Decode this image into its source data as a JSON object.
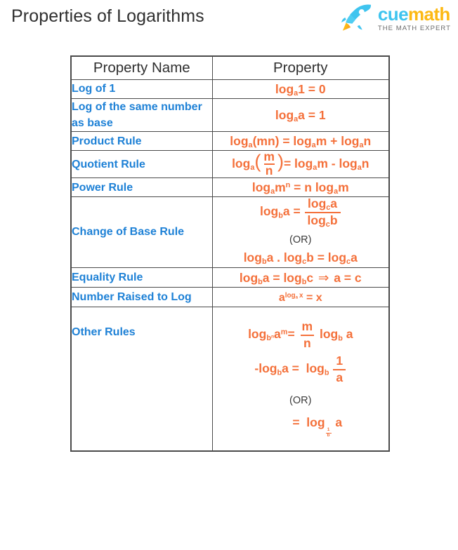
{
  "header": {
    "title": "Properties of Logarithms",
    "logo": {
      "icon": "rocket-icon",
      "word_1": "cue",
      "word_2": "math",
      "tagline": "THE MATH EXPERT",
      "color_cue": "#3FC4EF",
      "color_math": "#FDB913",
      "color_tagline": "#6b6b6b"
    }
  },
  "colors": {
    "property_name": "#1E81D6",
    "formula": "#F4703A",
    "border": "#4a4a4a",
    "heading": "#2f2f2f",
    "or_text": "#3a3a3a"
  },
  "table": {
    "columns": [
      "Property Name",
      "Property"
    ],
    "rows": [
      {
        "name": "Log of 1",
        "formula_text": "log_a 1 = 0",
        "log_base": "a",
        "arg": "1",
        "result": "0"
      },
      {
        "name": "Log of the same number as base",
        "formula_text": "log_a a = 1",
        "log_base": "a",
        "arg": "a",
        "result": "1"
      },
      {
        "name": "Product Rule",
        "formula_text": "log_a(mn) = log_a m + log_a n",
        "base": "a",
        "left_arg": "(mn)",
        "op": "+",
        "right_1": "m",
        "right_2": "n"
      },
      {
        "name": "Quotient Rule",
        "formula_text": "log_a(m/n) = log_a m - log_a n",
        "base": "a",
        "numerator": "m",
        "denominator": "n",
        "op": "-",
        "right_1": "m",
        "right_2": "n"
      },
      {
        "name": "Power Rule",
        "formula_text": "log_a m^n = n log_a m",
        "base": "a",
        "arg": "m",
        "exponent": "n",
        "coefficient": "n"
      },
      {
        "name": "Change of Base Rule",
        "formula_text": "log_b a = log_c a / log_c b",
        "alt_text": "log_b a . log_c b = log_c a",
        "or_label": "(OR)",
        "base_b": "b",
        "base_c": "c",
        "arg_a": "a",
        "arg_b": "b"
      },
      {
        "name": "Equality Rule",
        "formula_text": "log_b a = log_b c  ⇒  a = c",
        "base": "b",
        "arg_1": "a",
        "arg_2": "c",
        "implies": "⇒"
      },
      {
        "name": "Number Raised to Log",
        "formula_text": "a^(log_a x) = x",
        "base": "a",
        "log_base": "a",
        "arg": "x",
        "result": "x"
      },
      {
        "name": "Other Rules",
        "formula_1": "log_(b^n) a^m = (m/n) log_b a",
        "formula_2": "-log_b a = log_b (1/a)",
        "or_label": "(OR)",
        "formula_3": "= log_(1/b) a",
        "base": "b",
        "base_exp": "n",
        "arg": "a",
        "arg_exp": "m",
        "frac_num": "m",
        "frac_den": "n"
      }
    ]
  }
}
